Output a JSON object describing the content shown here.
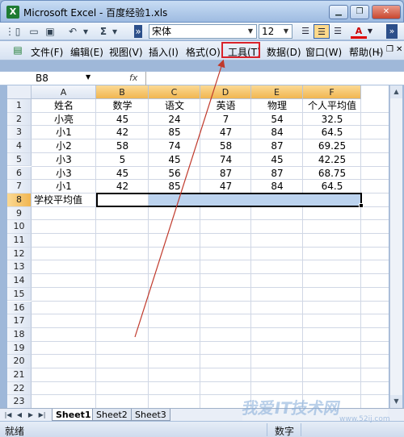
{
  "window": {
    "app_icon": "X",
    "title": "Microsoft Excel - 百度经验1.xls",
    "minimize_icon": "minimize-icon",
    "restore_icon": "restore-icon",
    "close_icon": "close-icon"
  },
  "toolbar": {
    "sum_label": "Σ",
    "font_name": "宋体",
    "font_size": "12",
    "font_color_label": "A"
  },
  "menu": {
    "items": [
      {
        "label": "文件(F)"
      },
      {
        "label": "编辑(E)"
      },
      {
        "label": "视图(V)"
      },
      {
        "label": "插入(I)"
      },
      {
        "label": "格式(O)"
      },
      {
        "label": "工具(T)"
      },
      {
        "label": "数据(D)"
      },
      {
        "label": "窗口(W)"
      },
      {
        "label": "帮助(H)"
      }
    ],
    "highlighted": "工具(T)"
  },
  "formula_bar": {
    "name_box": "B8",
    "fx_label": "fx",
    "formula": ""
  },
  "sheet": {
    "columns": [
      "A",
      "B",
      "C",
      "D",
      "E",
      "F"
    ],
    "selected_columns": [
      "B",
      "C",
      "D",
      "E",
      "F"
    ],
    "row_numbers": [
      "1",
      "2",
      "3",
      "4",
      "5",
      "6",
      "7",
      "8",
      "9",
      "10",
      "11",
      "12",
      "13",
      "14",
      "15",
      "16",
      "17",
      "18",
      "19",
      "20",
      "21",
      "22",
      "23"
    ],
    "selected_row": "8",
    "rows": [
      [
        "姓名",
        "数学",
        "语文",
        "英语",
        "物理",
        "个人平均值"
      ],
      [
        "小亮",
        "45",
        "24",
        "7",
        "54",
        "32.5"
      ],
      [
        "小1",
        "42",
        "85",
        "47",
        "84",
        "64.5"
      ],
      [
        "小2",
        "58",
        "74",
        "58",
        "87",
        "69.25"
      ],
      [
        "小3",
        "5",
        "45",
        "74",
        "45",
        "42.25"
      ],
      [
        "小3",
        "45",
        "56",
        "87",
        "87",
        "68.75"
      ],
      [
        "小1",
        "42",
        "85",
        "47",
        "84",
        "64.5"
      ],
      [
        "学校平均值",
        "",
        "",
        "",
        "",
        ""
      ]
    ]
  },
  "tabs": {
    "sheets": [
      "Sheet1",
      "Sheet2",
      "Sheet3"
    ],
    "active": "Sheet1"
  },
  "status": {
    "mode": "就绪",
    "indicator": "数字"
  },
  "watermark": {
    "text": "我爱IT技术网",
    "sub": "www.52ij.com"
  },
  "colors": {
    "annotation_red": "#d9232a",
    "selection_blue": "#bcd3ee",
    "header_selected": "#f1b651"
  }
}
